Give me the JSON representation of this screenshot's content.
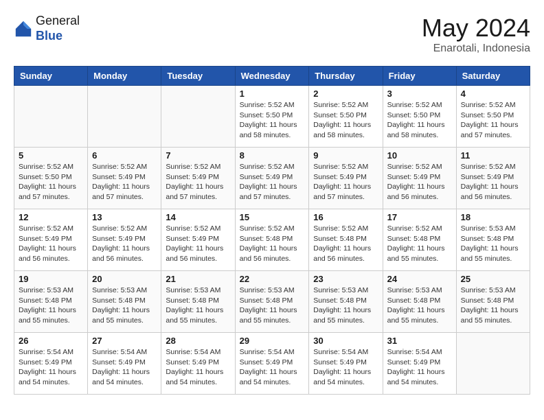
{
  "header": {
    "logo_line1": "General",
    "logo_line2": "Blue",
    "month": "May 2024",
    "location": "Enarotali, Indonesia"
  },
  "weekdays": [
    "Sunday",
    "Monday",
    "Tuesday",
    "Wednesday",
    "Thursday",
    "Friday",
    "Saturday"
  ],
  "weeks": [
    [
      {
        "day": "",
        "info": ""
      },
      {
        "day": "",
        "info": ""
      },
      {
        "day": "",
        "info": ""
      },
      {
        "day": "1",
        "info": "Sunrise: 5:52 AM\nSunset: 5:50 PM\nDaylight: 11 hours\nand 58 minutes."
      },
      {
        "day": "2",
        "info": "Sunrise: 5:52 AM\nSunset: 5:50 PM\nDaylight: 11 hours\nand 58 minutes."
      },
      {
        "day": "3",
        "info": "Sunrise: 5:52 AM\nSunset: 5:50 PM\nDaylight: 11 hours\nand 58 minutes."
      },
      {
        "day": "4",
        "info": "Sunrise: 5:52 AM\nSunset: 5:50 PM\nDaylight: 11 hours\nand 57 minutes."
      }
    ],
    [
      {
        "day": "5",
        "info": "Sunrise: 5:52 AM\nSunset: 5:50 PM\nDaylight: 11 hours\nand 57 minutes."
      },
      {
        "day": "6",
        "info": "Sunrise: 5:52 AM\nSunset: 5:49 PM\nDaylight: 11 hours\nand 57 minutes."
      },
      {
        "day": "7",
        "info": "Sunrise: 5:52 AM\nSunset: 5:49 PM\nDaylight: 11 hours\nand 57 minutes."
      },
      {
        "day": "8",
        "info": "Sunrise: 5:52 AM\nSunset: 5:49 PM\nDaylight: 11 hours\nand 57 minutes."
      },
      {
        "day": "9",
        "info": "Sunrise: 5:52 AM\nSunset: 5:49 PM\nDaylight: 11 hours\nand 57 minutes."
      },
      {
        "day": "10",
        "info": "Sunrise: 5:52 AM\nSunset: 5:49 PM\nDaylight: 11 hours\nand 56 minutes."
      },
      {
        "day": "11",
        "info": "Sunrise: 5:52 AM\nSunset: 5:49 PM\nDaylight: 11 hours\nand 56 minutes."
      }
    ],
    [
      {
        "day": "12",
        "info": "Sunrise: 5:52 AM\nSunset: 5:49 PM\nDaylight: 11 hours\nand 56 minutes."
      },
      {
        "day": "13",
        "info": "Sunrise: 5:52 AM\nSunset: 5:49 PM\nDaylight: 11 hours\nand 56 minutes."
      },
      {
        "day": "14",
        "info": "Sunrise: 5:52 AM\nSunset: 5:49 PM\nDaylight: 11 hours\nand 56 minutes."
      },
      {
        "day": "15",
        "info": "Sunrise: 5:52 AM\nSunset: 5:48 PM\nDaylight: 11 hours\nand 56 minutes."
      },
      {
        "day": "16",
        "info": "Sunrise: 5:52 AM\nSunset: 5:48 PM\nDaylight: 11 hours\nand 56 minutes."
      },
      {
        "day": "17",
        "info": "Sunrise: 5:52 AM\nSunset: 5:48 PM\nDaylight: 11 hours\nand 55 minutes."
      },
      {
        "day": "18",
        "info": "Sunrise: 5:53 AM\nSunset: 5:48 PM\nDaylight: 11 hours\nand 55 minutes."
      }
    ],
    [
      {
        "day": "19",
        "info": "Sunrise: 5:53 AM\nSunset: 5:48 PM\nDaylight: 11 hours\nand 55 minutes."
      },
      {
        "day": "20",
        "info": "Sunrise: 5:53 AM\nSunset: 5:48 PM\nDaylight: 11 hours\nand 55 minutes."
      },
      {
        "day": "21",
        "info": "Sunrise: 5:53 AM\nSunset: 5:48 PM\nDaylight: 11 hours\nand 55 minutes."
      },
      {
        "day": "22",
        "info": "Sunrise: 5:53 AM\nSunset: 5:48 PM\nDaylight: 11 hours\nand 55 minutes."
      },
      {
        "day": "23",
        "info": "Sunrise: 5:53 AM\nSunset: 5:48 PM\nDaylight: 11 hours\nand 55 minutes."
      },
      {
        "day": "24",
        "info": "Sunrise: 5:53 AM\nSunset: 5:48 PM\nDaylight: 11 hours\nand 55 minutes."
      },
      {
        "day": "25",
        "info": "Sunrise: 5:53 AM\nSunset: 5:48 PM\nDaylight: 11 hours\nand 55 minutes."
      }
    ],
    [
      {
        "day": "26",
        "info": "Sunrise: 5:54 AM\nSunset: 5:49 PM\nDaylight: 11 hours\nand 54 minutes."
      },
      {
        "day": "27",
        "info": "Sunrise: 5:54 AM\nSunset: 5:49 PM\nDaylight: 11 hours\nand 54 minutes."
      },
      {
        "day": "28",
        "info": "Sunrise: 5:54 AM\nSunset: 5:49 PM\nDaylight: 11 hours\nand 54 minutes."
      },
      {
        "day": "29",
        "info": "Sunrise: 5:54 AM\nSunset: 5:49 PM\nDaylight: 11 hours\nand 54 minutes."
      },
      {
        "day": "30",
        "info": "Sunrise: 5:54 AM\nSunset: 5:49 PM\nDaylight: 11 hours\nand 54 minutes."
      },
      {
        "day": "31",
        "info": "Sunrise: 5:54 AM\nSunset: 5:49 PM\nDaylight: 11 hours\nand 54 minutes."
      },
      {
        "day": "",
        "info": ""
      }
    ]
  ]
}
